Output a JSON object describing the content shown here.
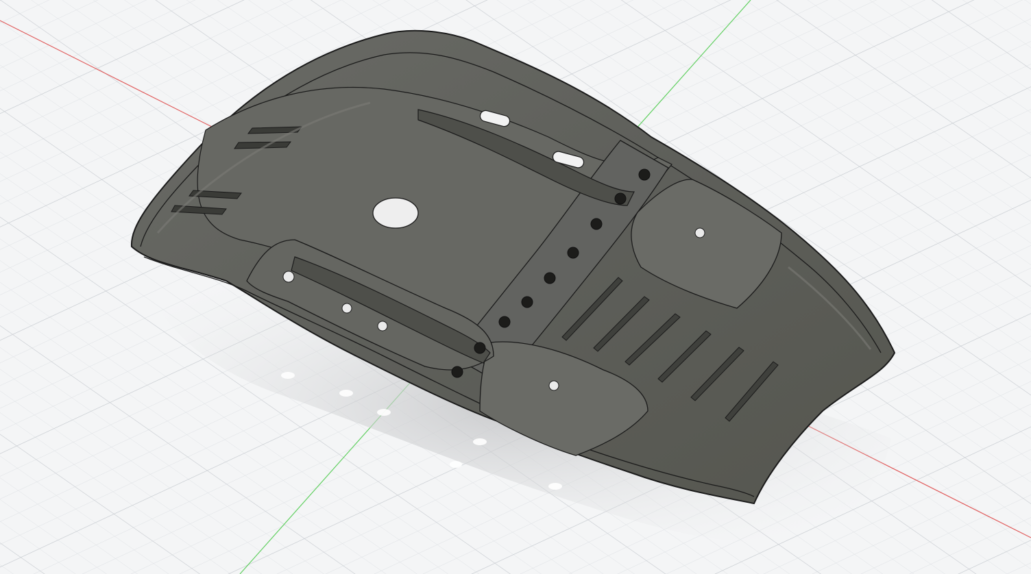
{
  "viewport": {
    "background": "#f4f5f6",
    "grid_minor_color": "#dfe2e5",
    "grid_major_color": "#c9cdd2",
    "x_axis_color": "#e05a5a",
    "y_axis_color": "#5fcf5f"
  },
  "model": {
    "body_color": "#5f605b",
    "edge_color": "#1a1a1a",
    "highlight_color": "#7b7c76",
    "shadow_color": "#c9cacc"
  }
}
